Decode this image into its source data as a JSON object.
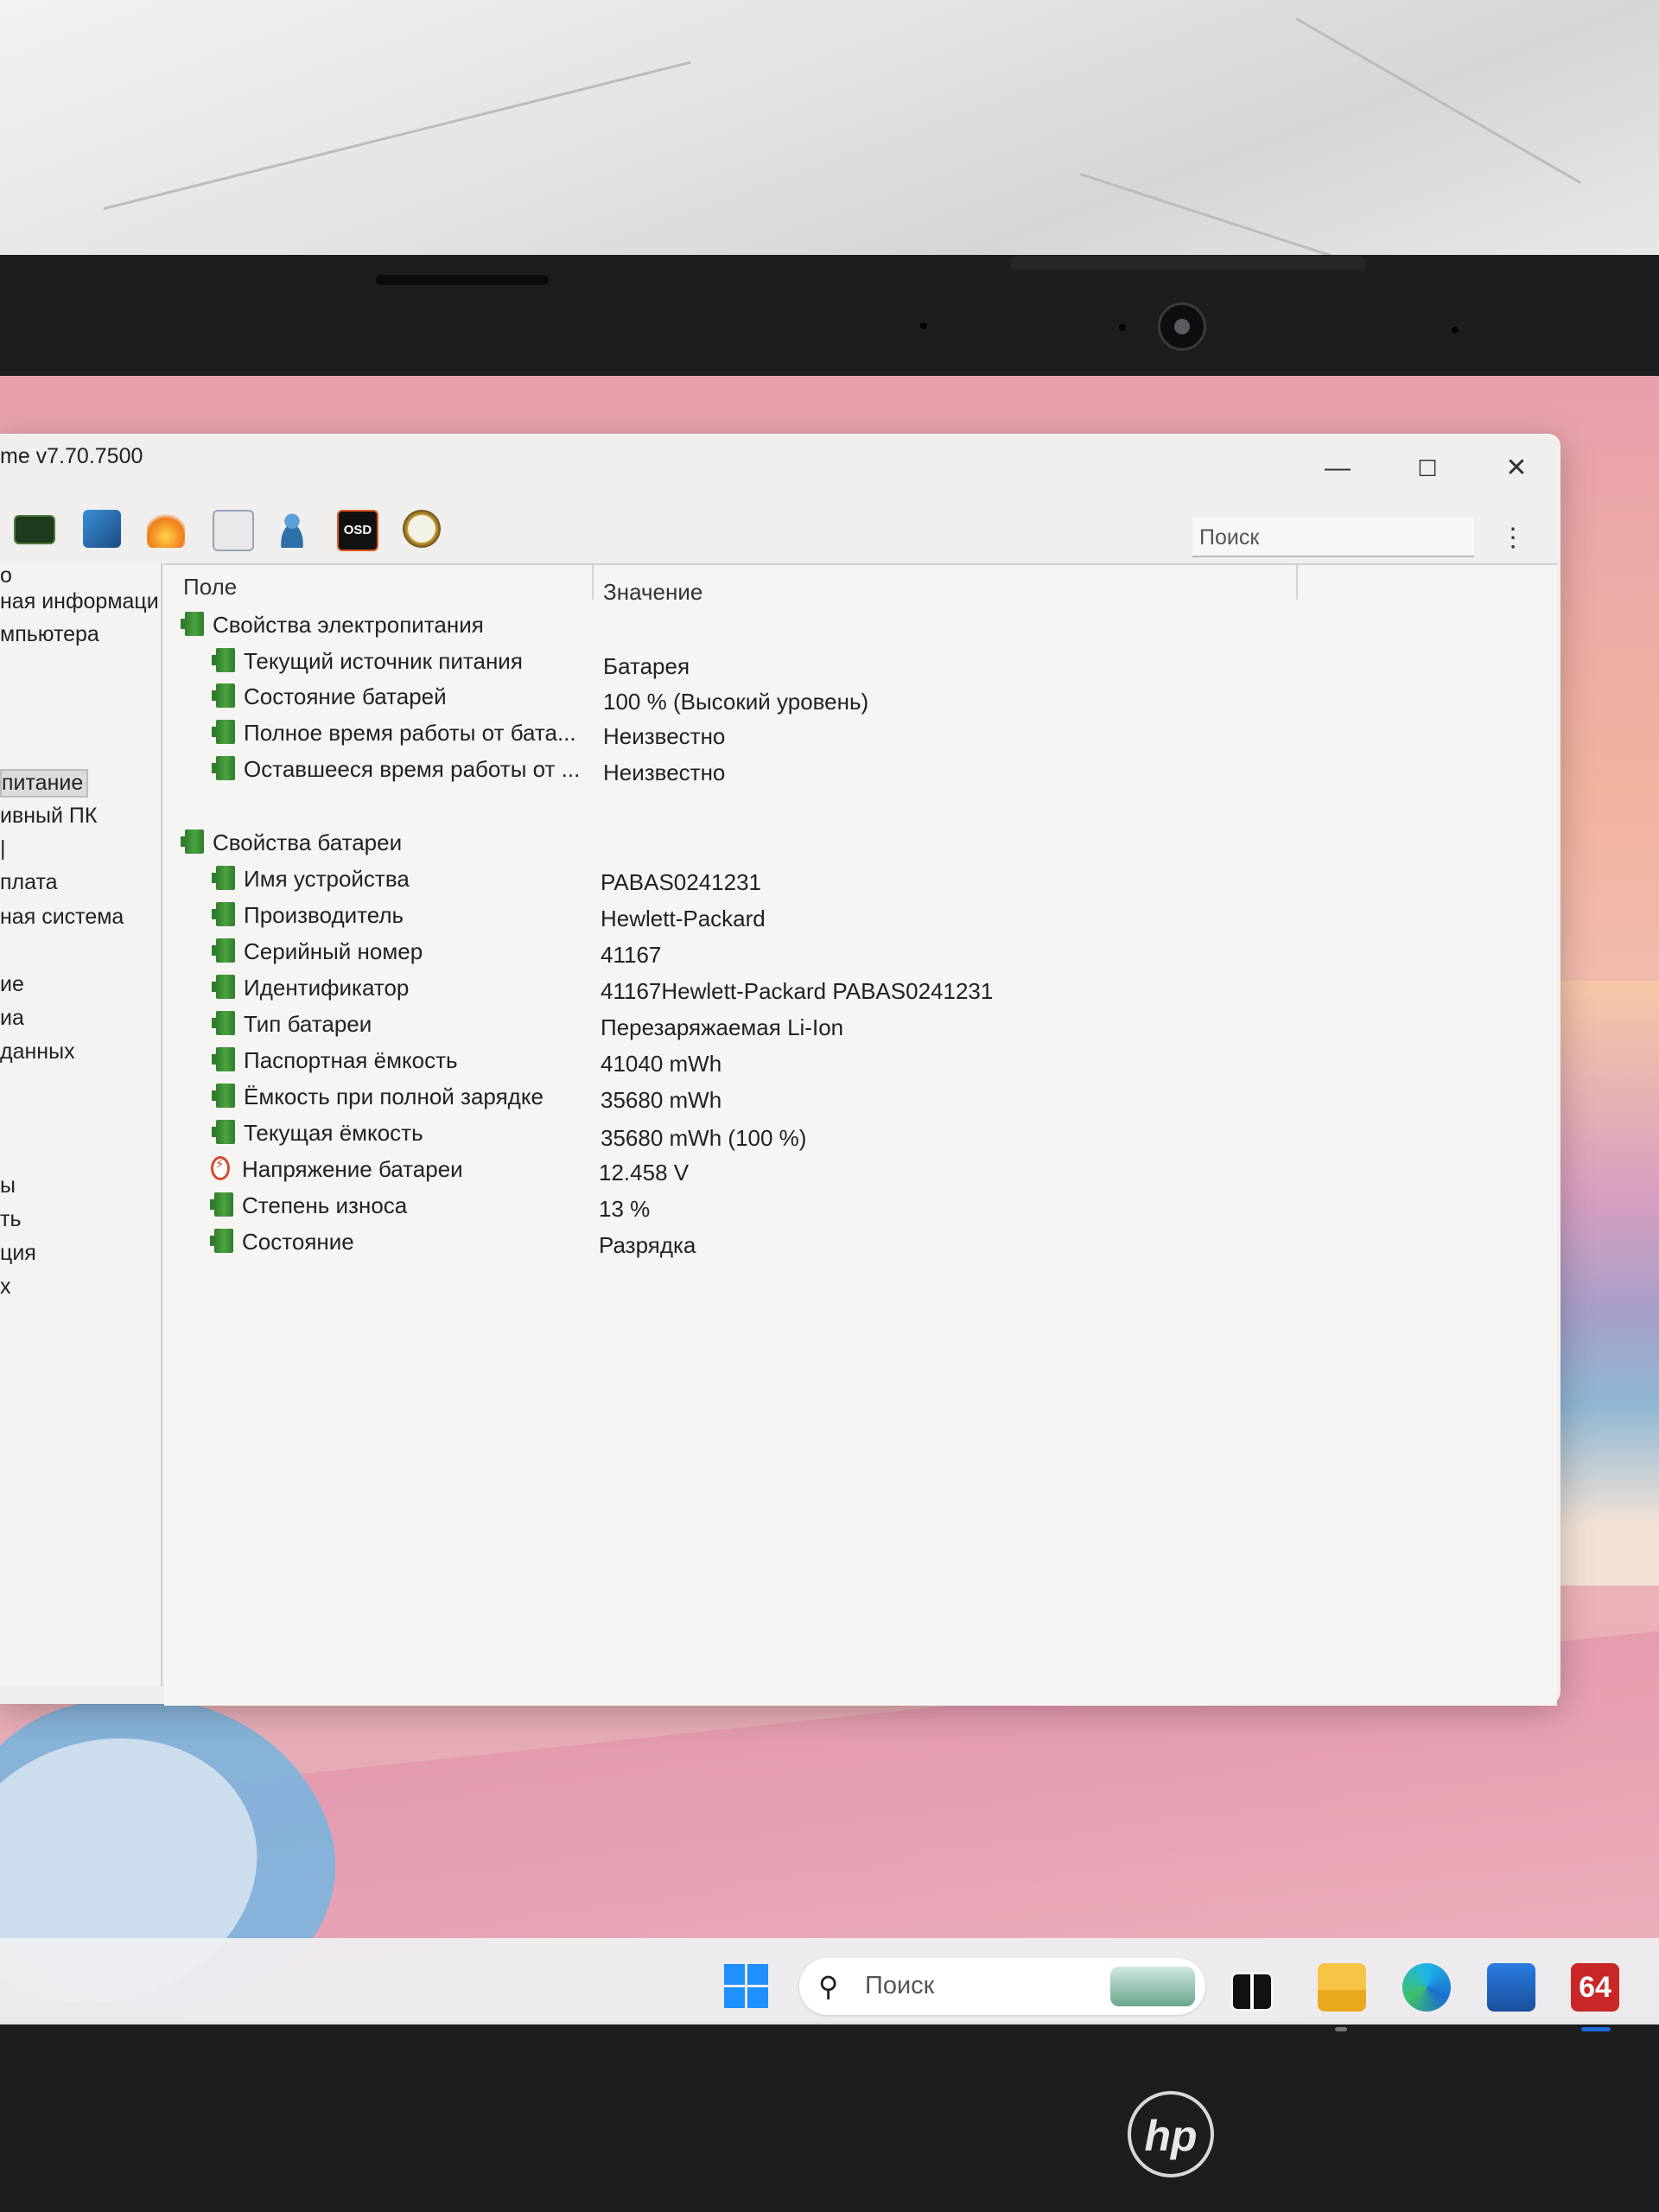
{
  "window": {
    "title": "me v7.70.7500",
    "controls": {
      "minimize": "—",
      "maximize": "☐",
      "close": "✕"
    },
    "search_placeholder": "Поиск",
    "menu_glyph": "⋮",
    "toolbar_icons": [
      "memory-icon",
      "network-icon",
      "flame-icon",
      "checklist-icon",
      "user-icon",
      "osd-icon",
      "gauge-icon"
    ],
    "osd_label": "OSD"
  },
  "tree": {
    "items": [
      {
        "label": "о"
      },
      {
        "label": "ная информаци"
      },
      {
        "label": "мпьютера"
      },
      {
        "label": "питание",
        "selected": true
      },
      {
        "label": "ивный ПК"
      },
      {
        "label": "|"
      },
      {
        "label": "плата"
      },
      {
        "label": "ная система"
      },
      {
        "label": "ие"
      },
      {
        "label": "иа"
      },
      {
        "label": "данных"
      },
      {
        "label": "ы"
      },
      {
        "label": "ть"
      },
      {
        "label": "ция"
      },
      {
        "label": "х"
      }
    ]
  },
  "table": {
    "col_field": "Поле",
    "col_value": "Значение",
    "power_group": "Свойства электропитания",
    "power_rows": [
      {
        "field": "Текущий источник питания",
        "value": "Батарея"
      },
      {
        "field": "Состояние батарей",
        "value": "100 % (Высокий уровень)"
      },
      {
        "field": "Полное время работы от бата...",
        "value": "Неизвестно"
      },
      {
        "field": "Оставшееся время работы от ...",
        "value": "Неизвестно"
      }
    ],
    "battery_group": "Свойства батареи",
    "battery_rows": [
      {
        "field": "Имя устройства",
        "value": "PABAS0241231"
      },
      {
        "field": "Производитель",
        "value": "Hewlett-Packard"
      },
      {
        "field": "Серийный номер",
        "value": "41167"
      },
      {
        "field": "Идентификатор",
        "value": "41167Hewlett-Packard PABAS0241231"
      },
      {
        "field": "Тип батареи",
        "value": "Перезаряжаемая Li-Ion"
      },
      {
        "field": "Паспортная ёмкость",
        "value": "41040 mWh"
      },
      {
        "field": "Ёмкость при полной зарядке",
        "value": "35680 mWh"
      },
      {
        "field": "Текущая ёмкость",
        "value": "35680 mWh  (100 %)"
      },
      {
        "field": "Напряжение батареи",
        "value": "12.458 V"
      },
      {
        "field": "Степень износа",
        "value": "13 %"
      },
      {
        "field": "Состояние",
        "value": "Разрядка"
      }
    ]
  },
  "taskbar": {
    "search_placeholder": "Поиск",
    "search_glyph": "⚲",
    "aida_badge": "64",
    "apps": [
      "start-icon",
      "taskview-icon",
      "file-explorer-icon",
      "edge-icon",
      "store-icon",
      "aida64-icon"
    ]
  },
  "laptop": {
    "brand": "hp"
  }
}
